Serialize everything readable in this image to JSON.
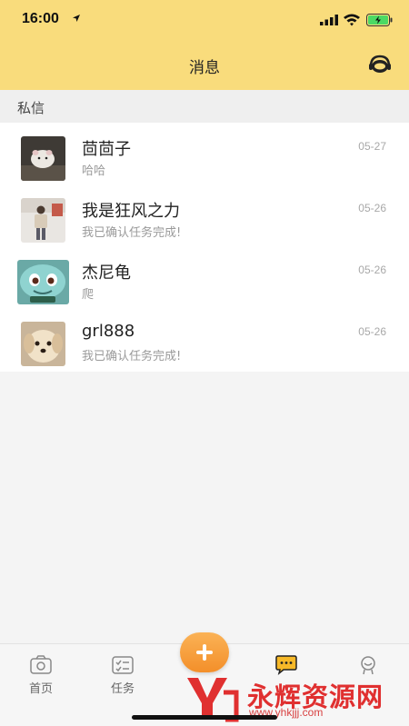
{
  "status_bar": {
    "time": "16:00"
  },
  "header": {
    "title": "消息"
  },
  "section": {
    "title": "私信"
  },
  "messages": [
    {
      "name": "茴茴子",
      "preview": "哈哈",
      "date": "05-27"
    },
    {
      "name": "我是狂风之力",
      "preview": "我已确认任务完成!",
      "date": "05-26"
    },
    {
      "name": "杰尼龟",
      "preview": "爬",
      "date": "05-26"
    },
    {
      "name": "grl888",
      "preview": "我已确认任务完成!",
      "date": "05-26"
    }
  ],
  "tabbar": {
    "items": [
      {
        "label": "首页",
        "icon": "home-icon"
      },
      {
        "label": "任务",
        "icon": "task-icon"
      },
      {
        "label": "",
        "icon": "message-icon"
      },
      {
        "label": "",
        "icon": "profile-icon"
      }
    ],
    "fab_icon": "plus-icon",
    "accent": "#f7a340"
  },
  "watermark": {
    "text": "永辉资源网",
    "url": "www.yhkjjj.com"
  }
}
